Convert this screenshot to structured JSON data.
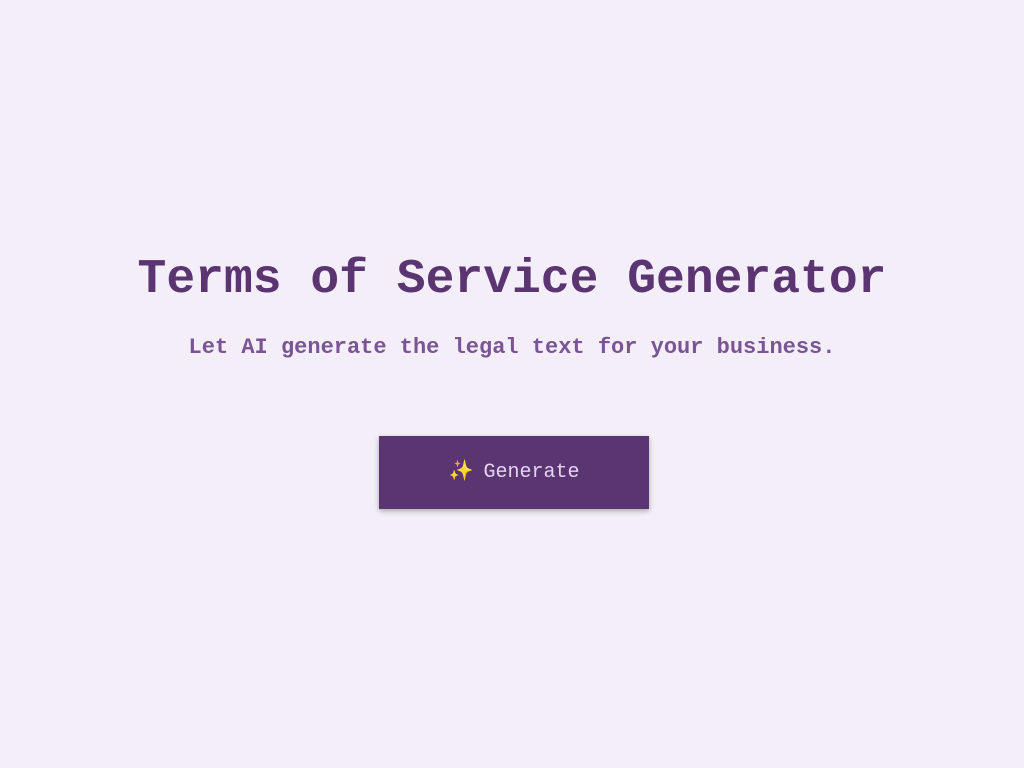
{
  "header": {
    "title": "Terms of Service Generator",
    "subtitle": "Let AI generate the legal text for your business."
  },
  "actions": {
    "generate_label": "Generate",
    "generate_icon": "sparkles-icon",
    "generate_icon_glyph": "✨"
  },
  "colors": {
    "background": "#f3eef7",
    "primary": "#5b3472",
    "subtitle": "#7a5495",
    "button_text": "#e3d6ec"
  }
}
